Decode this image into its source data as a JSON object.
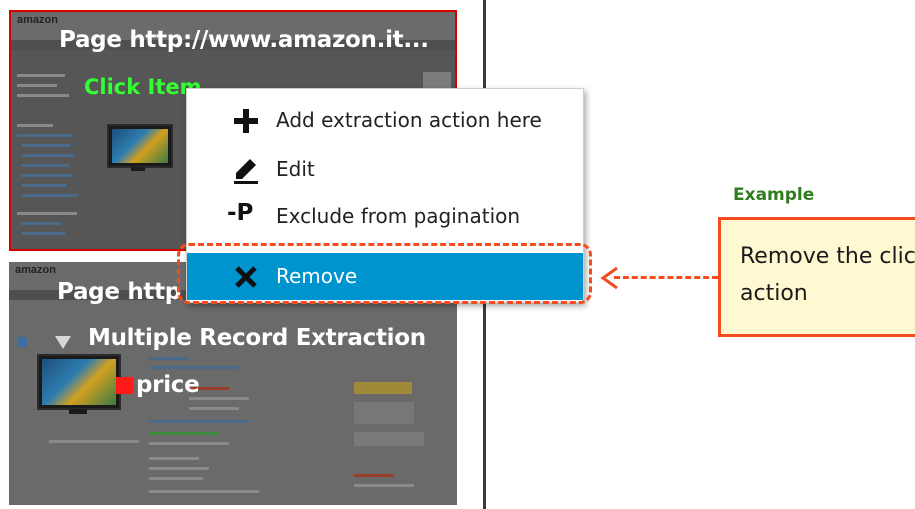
{
  "workflow": {
    "step1": {
      "logo": "amazon",
      "title": "Page  http://www.amazon.it...",
      "action_label": "Click Item"
    },
    "step2": {
      "logo": "amazon",
      "title": "Page  http",
      "extraction_label": "Multiple Record Extraction",
      "field_label": "price"
    }
  },
  "context_menu": {
    "items": [
      {
        "icon": "plus-icon",
        "label": "Add extraction action here"
      },
      {
        "icon": "pencil-icon",
        "label": "Edit"
      },
      {
        "icon": "exclude-pagination-icon",
        "icon_text": "-P",
        "label": "Exclude from pagination"
      },
      {
        "icon": "close-icon",
        "label": "Remove",
        "selected": true
      }
    ],
    "highlight_color": "#0094cf"
  },
  "annotation": {
    "example_label": "Example",
    "note": "Remove the click action",
    "accent_color": "#f44c1d"
  }
}
